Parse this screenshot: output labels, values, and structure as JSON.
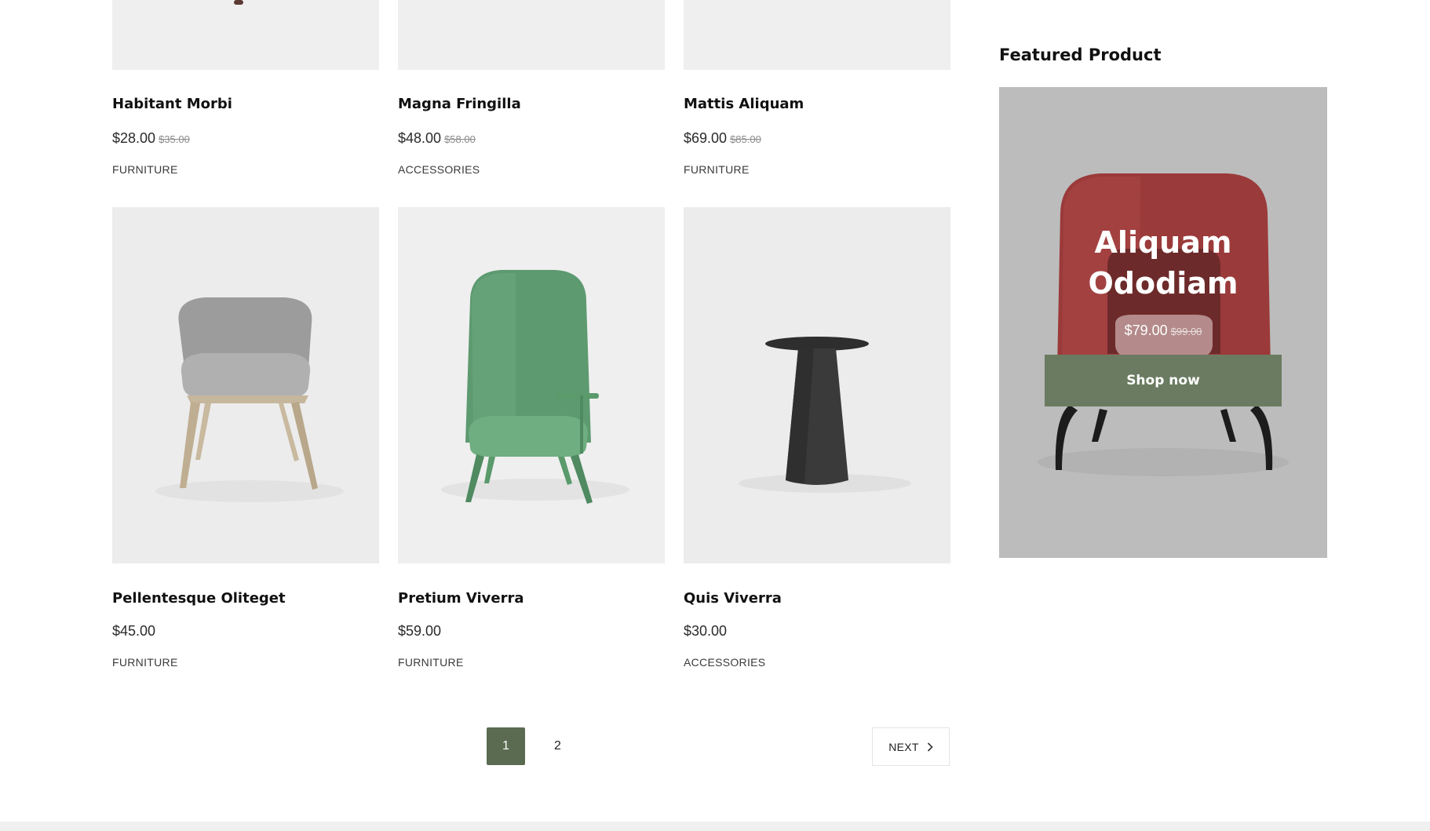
{
  "products_top": [
    {
      "name": "Habitant Morbi",
      "price": "$28.00",
      "old_price": "$35.00",
      "category": "FURNITURE"
    },
    {
      "name": "Magna Fringilla",
      "price": "$48.00",
      "old_price": "$58.00",
      "category": "ACCESSORIES"
    },
    {
      "name": "Mattis Aliquam",
      "price": "$69.00",
      "old_price": "$85.00",
      "category": "FURNITURE"
    }
  ],
  "products_bottom": [
    {
      "name": "Pellentesque Oliteget",
      "price": "$45.00",
      "category": "FURNITURE",
      "image": "grey-armchair"
    },
    {
      "name": "Pretium Viverra",
      "price": "$59.00",
      "category": "FURNITURE",
      "image": "green-highback-chair"
    },
    {
      "name": "Quis Viverra",
      "price": "$30.00",
      "category": "ACCESSORIES",
      "image": "dark-side-table"
    }
  ],
  "pagination": {
    "pages": [
      "1",
      "2"
    ],
    "current": "1",
    "next_label": "NEXT"
  },
  "featured": {
    "heading": "Featured Product",
    "title_line1": "Aliquam",
    "title_line2": "Ododiam",
    "price": "$79.00",
    "old_price": "$99.00",
    "cta": "Shop now",
    "image": "red-armchair"
  },
  "colors": {
    "accent": "#5a6b52",
    "cta": "#6b7b61",
    "card_bg": "#efefef",
    "featured_bg": "#bcbcbc"
  }
}
